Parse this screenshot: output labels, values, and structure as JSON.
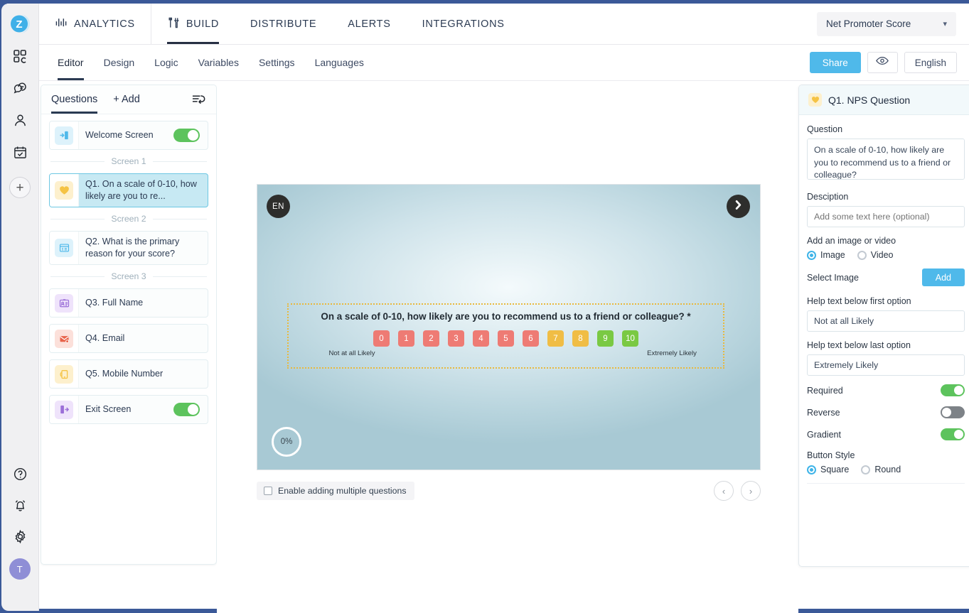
{
  "theme": {
    "accent_blue": "#4fb9ea",
    "nav_dark": "#2b3a52",
    "toggle_on": "#5dc35d",
    "toggle_off": "#7d8287",
    "nps_red": "#ee7b74",
    "nps_yellow": "#f0bd45",
    "nps_green": "#7ac943",
    "selected_item_bg": "#c7e9f3",
    "dotted_outline": "#e8b93e",
    "top_strip": "#3b5998"
  },
  "rail": {
    "logo_letter": "Z",
    "items": [
      {
        "icon": "grid-icon",
        "label": "Dashboard"
      },
      {
        "icon": "feedback-chat-icon",
        "label": "Feedback"
      },
      {
        "icon": "contacts-person-icon",
        "label": "Contacts"
      },
      {
        "icon": "calendar-check-icon",
        "label": "Schedule"
      }
    ],
    "add_label": "+",
    "bottom_items": [
      {
        "icon": "help-circle-icon",
        "label": "Help"
      },
      {
        "icon": "bell-icon",
        "label": "Notifications"
      },
      {
        "icon": "gear-icon",
        "label": "Settings"
      }
    ],
    "avatar_initial": "T"
  },
  "header": {
    "modules": [
      {
        "label": "ANALYTICS",
        "icon": "bar-chart-icon",
        "active": false
      },
      {
        "label": "BUILD",
        "icon": "tools-icon",
        "active": true
      },
      {
        "label": "DISTRIBUTE",
        "icon": "",
        "active": false
      },
      {
        "label": "ALERTS",
        "icon": "",
        "active": false
      },
      {
        "label": "INTEGRATIONS",
        "icon": "",
        "active": false
      }
    ],
    "survey_select": {
      "value": "Net Promoter Score",
      "caret": "chevron-down-icon"
    }
  },
  "subnav": {
    "tabs": [
      {
        "label": "Editor",
        "active": true
      },
      {
        "label": "Design",
        "active": false
      },
      {
        "label": "Logic",
        "active": false
      },
      {
        "label": "Variables",
        "active": false
      },
      {
        "label": "Settings",
        "active": false
      },
      {
        "label": "Languages",
        "active": false
      }
    ],
    "share_label": "Share",
    "preview_icon": "eye-icon",
    "language_label": "English"
  },
  "questions_panel": {
    "title": "Questions",
    "add_label": "+ Add",
    "reorder_icon": "reorder-undo-icon",
    "items": [
      {
        "kind": "screen",
        "label": "Welcome Screen",
        "icon": "enter-door-icon",
        "icon_bg": "#ddf2fb",
        "icon_fg": "#4fb9ea",
        "toggle": "on"
      },
      {
        "kind": "separator",
        "label": "Screen 1"
      },
      {
        "kind": "question",
        "label": "Q1. On a scale of 0-10, how likely are you to re...",
        "icon": "heart-icon",
        "icon_bg": "#fdf0cd",
        "icon_fg": "#f5c344",
        "selected": true
      },
      {
        "kind": "separator",
        "label": "Screen 2"
      },
      {
        "kind": "question",
        "label": "Q2. What is the primary reason for your score?",
        "icon": "textbox-icon",
        "icon_bg": "#ddf2fb",
        "icon_fg": "#4fb9ea",
        "selected": false
      },
      {
        "kind": "separator",
        "label": "Screen 3"
      },
      {
        "kind": "question",
        "label": "Q3. Full Name",
        "icon": "id-card-icon",
        "icon_bg": "#efe3fb",
        "icon_fg": "#9b6ed8",
        "selected": false
      },
      {
        "kind": "question",
        "label": "Q4. Email",
        "icon": "envelope-icon",
        "icon_bg": "#fce0da",
        "icon_fg": "#e8634a",
        "selected": false
      },
      {
        "kind": "question",
        "label": "Q5. Mobile Number",
        "icon": "mobile-phone-icon",
        "icon_bg": "#fdf0cd",
        "icon_fg": "#f5c344",
        "selected": false
      },
      {
        "kind": "screen",
        "label": "Exit Screen",
        "icon": "exit-door-icon",
        "icon_bg": "#efe3fb",
        "icon_fg": "#9b6ed8",
        "toggle": "on"
      }
    ]
  },
  "preview": {
    "language_badge": "EN",
    "next_icon": "chevron-right-icon",
    "progress": "0%",
    "question_text": "On a scale of 0-10, how likely are you to recommend us to a friend or colleague? *",
    "scale": [
      {
        "value": "0",
        "color": "#ee7b74"
      },
      {
        "value": "1",
        "color": "#ee7b74"
      },
      {
        "value": "2",
        "color": "#ee7b74"
      },
      {
        "value": "3",
        "color": "#ee7b74"
      },
      {
        "value": "4",
        "color": "#ee7b74"
      },
      {
        "value": "5",
        "color": "#ee7b74"
      },
      {
        "value": "6",
        "color": "#ee7b74"
      },
      {
        "value": "7",
        "color": "#f0bd45"
      },
      {
        "value": "8",
        "color": "#f0bd45"
      },
      {
        "value": "9",
        "color": "#7ac943"
      },
      {
        "value": "10",
        "color": "#7ac943"
      }
    ],
    "help_first": "Not at all Likely",
    "help_last": "Extremely Likely",
    "footer": {
      "checkbox_label": "Enable adding multiple questions",
      "checkbox_checked": false,
      "prev_icon": "chevron-left-icon",
      "next_icon": "chevron-right-icon"
    }
  },
  "properties": {
    "header_title": "Q1. NPS Question",
    "header_icon": "heart-icon",
    "question_label": "Question",
    "question_value": "On a scale of 0-10, how likely are you to recommend us to a friend or colleague?",
    "description_label": "Desciption",
    "description_value": "",
    "description_placeholder": "Add some text here (optional)",
    "media_label": "Add an image or video",
    "media_options": [
      {
        "label": "Image",
        "selected": true
      },
      {
        "label": "Video",
        "selected": false
      }
    ],
    "select_image_label": "Select Image",
    "add_button_label": "Add",
    "help_first_label": "Help text below first option",
    "help_first_value": "Not at all Likely",
    "help_last_label": "Help text below last option",
    "help_last_value": "Extremely Likely",
    "toggles": [
      {
        "label": "Required",
        "state": "on"
      },
      {
        "label": "Reverse",
        "state": "off"
      },
      {
        "label": "Gradient",
        "state": "on"
      }
    ],
    "button_style_label": "Button Style",
    "button_style_options": [
      {
        "label": "Square",
        "selected": true
      },
      {
        "label": "Round",
        "selected": false
      }
    ]
  }
}
